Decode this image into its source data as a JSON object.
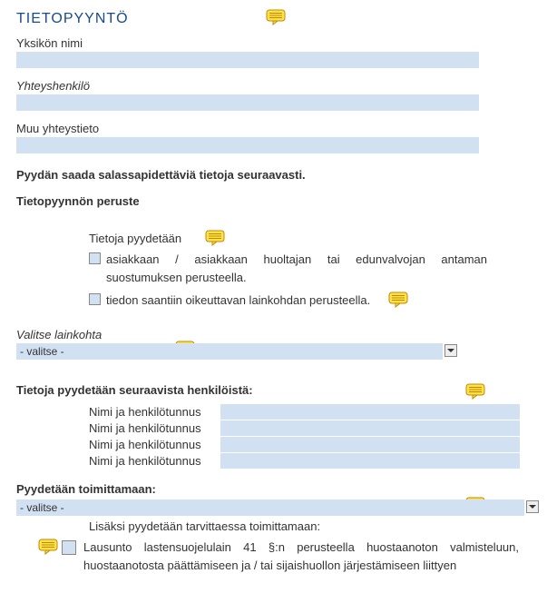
{
  "title": "TIETOPYYNTÖ",
  "fields": {
    "unit_label": "Yksikön nimi",
    "contact_label": "Yhteyshenkilö",
    "other_contact_label": "Muu yhteystieto"
  },
  "main_statement": "Pyydän saada salassapidettäviä tietoja seuraavasti.",
  "basis": {
    "heading": "Tietopyynnön peruste",
    "prompt": "Tietoja pyydetään",
    "option_consent": "asiakkaan / asiakkaan huoltajan tai edunvalvojan antaman suostumuksen perusteella.",
    "option_law": "tiedon saantiin oikeuttavan lainkohdan perusteella."
  },
  "law_select": {
    "label": "Valitse lainkohta",
    "value": "- valitse -"
  },
  "persons": {
    "heading": "Tietoja pyydetään seuraavista henkilöistä:",
    "rows": [
      "Nimi ja henkilötunnus",
      "Nimi ja henkilötunnus",
      "Nimi ja henkilötunnus",
      "Nimi ja henkilötunnus"
    ]
  },
  "delivery": {
    "heading": "Pyydetään toimittamaan:",
    "value": "- valitse -",
    "additional_label": "Lisäksi pyydetään tarvittaessa toimittamaan:",
    "statement_text": "Lausunto lastensuojelulain 41 §:n perusteella huostaanoton valmisteluun, huostaanotosta päättämiseen ja / tai sijaishuollon järjestämiseen liittyen"
  }
}
